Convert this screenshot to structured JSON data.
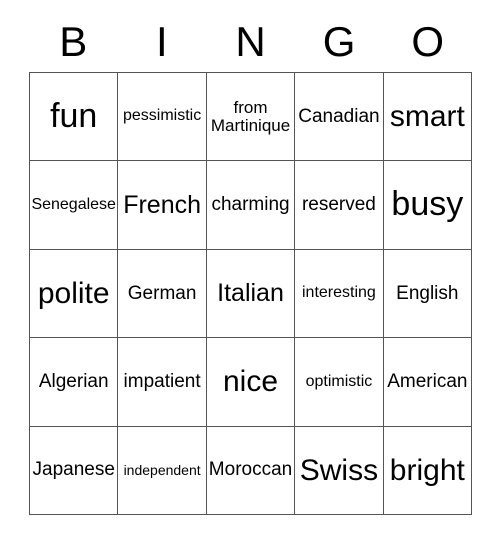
{
  "card": {
    "title": "Bingo Card",
    "header_letters": [
      "B",
      "I",
      "N",
      "G",
      "O"
    ],
    "columns": 5,
    "rows": 5,
    "border_color": "#555555",
    "text_color": "#000000",
    "background_color": "#ffffff",
    "cells": [
      [
        {
          "text": "fun",
          "size": "xl"
        },
        {
          "text": "pessimistic",
          "size": "xs"
        },
        {
          "text": "from Martinique",
          "size": "wrap"
        },
        {
          "text": "Canadian",
          "size": "sm"
        },
        {
          "text": "smart",
          "size": "lg"
        }
      ],
      [
        {
          "text": "Senegalese",
          "size": "xs"
        },
        {
          "text": "French",
          "size": "md"
        },
        {
          "text": "charming",
          "size": "sm"
        },
        {
          "text": "reserved",
          "size": "sm"
        },
        {
          "text": "busy",
          "size": "xl"
        }
      ],
      [
        {
          "text": "polite",
          "size": "lg"
        },
        {
          "text": "German",
          "size": "sm"
        },
        {
          "text": "Italian",
          "size": "md"
        },
        {
          "text": "interesting",
          "size": "xs"
        },
        {
          "text": "English",
          "size": "sm"
        }
      ],
      [
        {
          "text": "Algerian",
          "size": "sm"
        },
        {
          "text": "impatient",
          "size": "sm"
        },
        {
          "text": "nice",
          "size": "lg"
        },
        {
          "text": "optimistic",
          "size": "xs"
        },
        {
          "text": "American",
          "size": "sm"
        }
      ],
      [
        {
          "text": "Japanese",
          "size": "sm"
        },
        {
          "text": "independent",
          "size": "xxs"
        },
        {
          "text": "Moroccan",
          "size": "sm"
        },
        {
          "text": "Swiss",
          "size": "lg"
        },
        {
          "text": "bright",
          "size": "lg"
        }
      ]
    ]
  }
}
